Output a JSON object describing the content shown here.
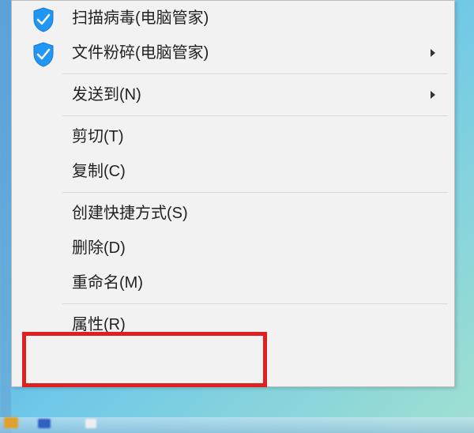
{
  "menu": {
    "items": [
      {
        "label": "扫描病毒(电脑管家)",
        "icon": "shield"
      },
      {
        "label": "文件粉碎(电脑管家)",
        "icon": "shield",
        "submenu": true
      },
      {
        "sep": true
      },
      {
        "label": "发送到(N)",
        "submenu": true
      },
      {
        "sep": true
      },
      {
        "label": "剪切(T)"
      },
      {
        "label": "复制(C)"
      },
      {
        "sep": true
      },
      {
        "label": "创建快捷方式(S)"
      },
      {
        "label": "删除(D)"
      },
      {
        "label": "重命名(M)"
      },
      {
        "sep": true
      },
      {
        "label": "属性(R)",
        "highlight": true
      }
    ]
  }
}
